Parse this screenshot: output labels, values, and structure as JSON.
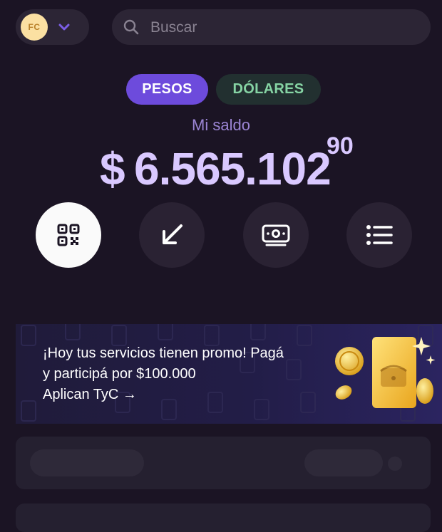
{
  "header": {
    "avatar_initials": "FC",
    "search_placeholder": "Buscar"
  },
  "currency_tabs": [
    {
      "label": "PESOS",
      "selected": true
    },
    {
      "label": "DÓLARES",
      "selected": false
    }
  ],
  "balance": {
    "label": "Mi saldo",
    "currency_symbol": "$",
    "amount": "6.565.102",
    "cents": "90"
  },
  "actions": [
    {
      "icon": "qr-code-icon"
    },
    {
      "icon": "arrow-down-left-icon"
    },
    {
      "icon": "cash-icon"
    },
    {
      "icon": "list-icon"
    }
  ],
  "promo": {
    "line1": "¡Hoy tus servicios tienen promo! Pagá",
    "line2": "y participá por $100.000",
    "cta": "Aplican TyC →"
  },
  "colors": {
    "background": "#1b1424",
    "accent": "#6d4bdc",
    "balance_text": "#d9c8ff",
    "dolares_text": "#86d4a4"
  }
}
